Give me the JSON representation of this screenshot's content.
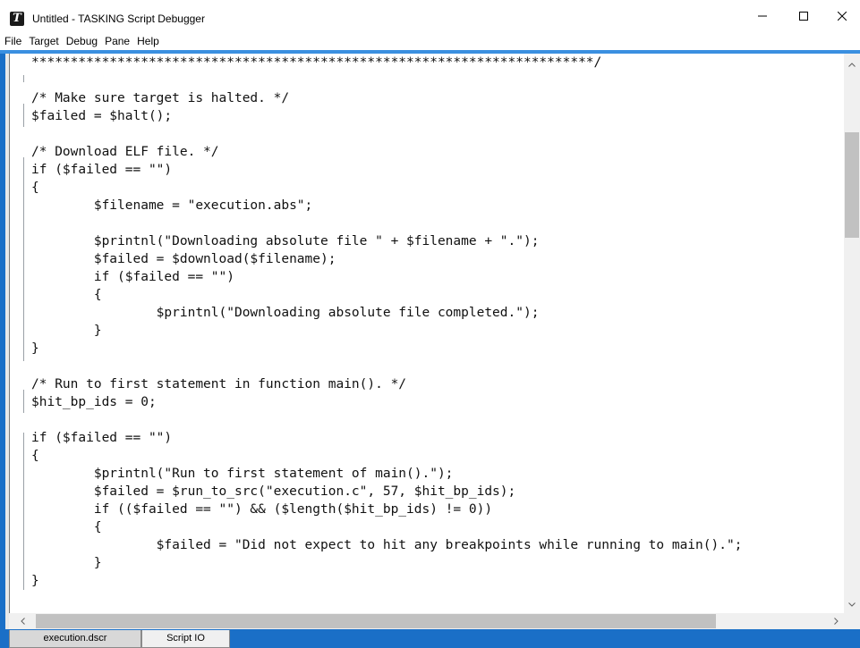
{
  "window": {
    "title": "Untitled - TASKING Script Debugger",
    "app_icon_letter": "T"
  },
  "menu": [
    "File",
    "Target",
    "Debug",
    "Pane",
    "Help"
  ],
  "editor": {
    "lines": [
      "************************************************************************/",
      "",
      "/* Make sure target is halted. */",
      "$failed = $halt();",
      "",
      "/* Download ELF file. */",
      "if ($failed == \"\")",
      "{",
      "        $filename = \"execution.abs\";",
      "",
      "        $printnl(\"Downloading absolute file \" + $filename + \".\");",
      "        $failed = $download($filename);",
      "        if ($failed == \"\")",
      "        {",
      "                $printnl(\"Downloading absolute file completed.\");",
      "        }",
      "}",
      "",
      "/* Run to first statement in function main(). */",
      "$hit_bp_ids = 0;",
      "",
      "if ($failed == \"\")",
      "{",
      "        $printnl(\"Run to first statement of main().\");",
      "        $failed = $run_to_src(\"execution.c\", 57, $hit_bp_ids);",
      "        if (($failed == \"\") && ($length($hit_bp_ids) != 0))",
      "        {",
      "                $failed = \"Did not expect to hit any breakpoints while running to main().\";",
      "        }",
      "}"
    ]
  },
  "tabs": [
    {
      "label": "execution.dscr",
      "active": true
    },
    {
      "label": "Script IO",
      "active": false
    }
  ],
  "icons": {
    "minimize": "minimize-icon",
    "maximize": "maximize-icon",
    "close": "close-icon",
    "scroll_up": "chevron-up-icon",
    "scroll_down": "chevron-down-icon",
    "scroll_left": "chevron-left-icon",
    "scroll_right": "chevron-right-icon"
  },
  "colors": {
    "frame_blue": "#1a6fc7"
  }
}
